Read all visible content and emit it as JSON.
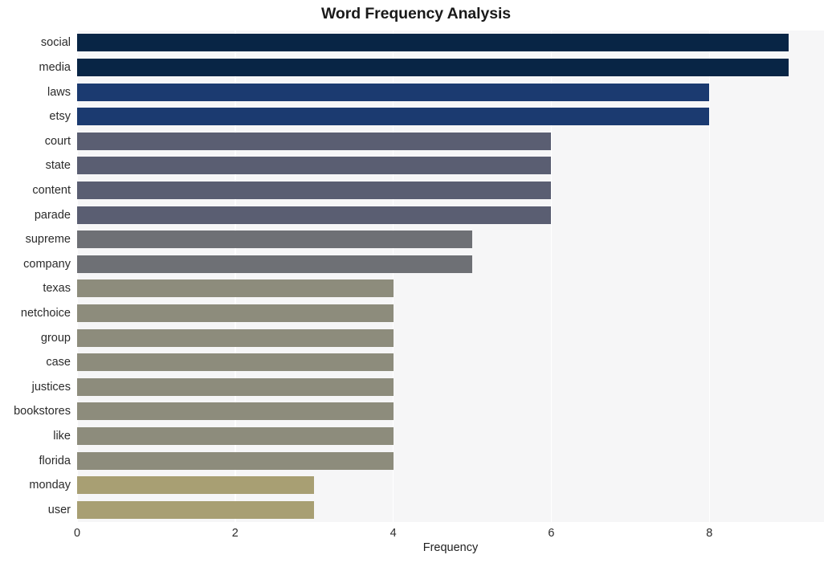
{
  "chart_data": {
    "type": "bar",
    "orientation": "horizontal",
    "title": "Word Frequency Analysis",
    "xlabel": "Frequency",
    "ylabel": "",
    "categories": [
      "social",
      "media",
      "laws",
      "etsy",
      "court",
      "state",
      "content",
      "parade",
      "supreme",
      "company",
      "texas",
      "netchoice",
      "group",
      "case",
      "justices",
      "bookstores",
      "like",
      "florida",
      "monday",
      "user"
    ],
    "values": [
      9,
      9,
      8,
      8,
      6,
      6,
      6,
      6,
      5,
      5,
      4,
      4,
      4,
      4,
      4,
      4,
      4,
      4,
      3,
      3
    ],
    "bar_colors": [
      "#082545",
      "#082545",
      "#1b3a70",
      "#1b3a70",
      "#5a5e72",
      "#5a5e72",
      "#5a5e72",
      "#5a5e72",
      "#6e7075",
      "#6e7075",
      "#8d8c7c",
      "#8d8c7c",
      "#8d8c7c",
      "#8d8c7c",
      "#8d8c7c",
      "#8d8c7c",
      "#8d8c7c",
      "#8d8c7c",
      "#a89f73",
      "#a89f73"
    ],
    "xlim": [
      0,
      9.45
    ],
    "xticks": [
      0,
      2,
      4,
      6,
      8
    ],
    "xtick_labels": [
      "0",
      "2",
      "4",
      "6",
      "8"
    ],
    "grid": true,
    "grid_axis": "x",
    "legend": null,
    "plot_background": "#f6f6f7",
    "figure_background": "#ffffff",
    "title_color": "#1a1a1a",
    "tick_color": "#2b2b2b"
  }
}
